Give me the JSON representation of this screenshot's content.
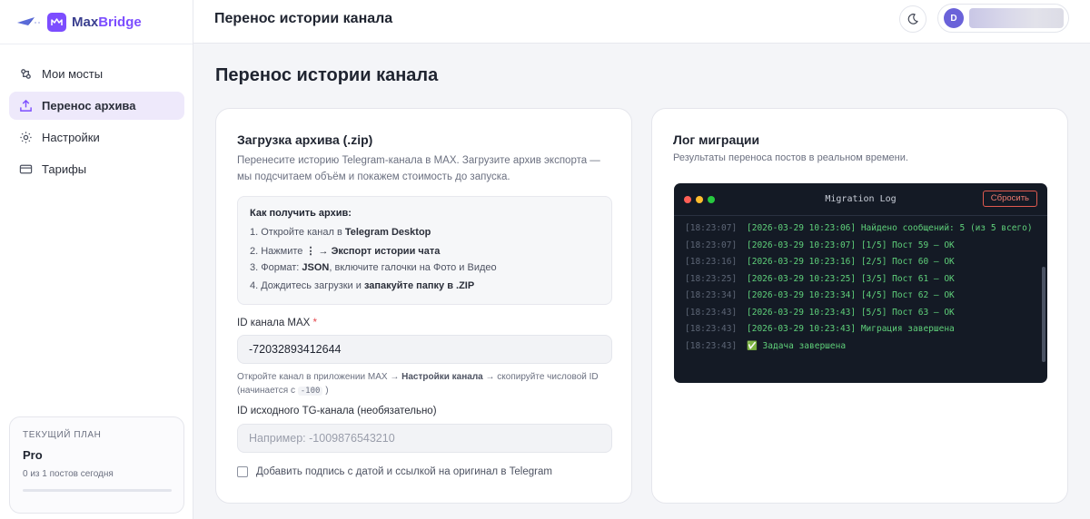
{
  "brand": {
    "name_part1": "Max",
    "name_part2": "Bridge"
  },
  "sidebar": {
    "items": [
      {
        "label": "Мои мосты",
        "icon": "bridge-icon"
      },
      {
        "label": "Перенос архива",
        "icon": "upload-icon",
        "active": true
      },
      {
        "label": "Настройки",
        "icon": "gear-icon"
      },
      {
        "label": "Тарифы",
        "icon": "card-icon"
      }
    ],
    "plan": {
      "label": "ТЕКУЩИЙ ПЛАН",
      "name": "Pro",
      "usage": "0 из 1 постов сегодня",
      "usage_fraction": 0
    }
  },
  "header": {
    "title": "Перенос истории канала",
    "user_initial": "D"
  },
  "page": {
    "heading": "Перенос истории канала"
  },
  "upload": {
    "title": "Загрузка архива (.zip)",
    "description": "Перенесите историю Telegram-канала в MAX. Загрузите архив экспорта — мы подсчитаем объём и покажем стоимость до запуска.",
    "howto": {
      "heading": "Как получить архив:",
      "s1_a": "1. Откройте канал в ",
      "s1_b": "Telegram Desktop",
      "s2_a": "2. Нажмите ",
      "s2_b": "⋮ → Экспорт истории чата",
      "s3_a": "3. Формат: ",
      "s3_b": "JSON",
      "s3_c": ", включите галочки на Фото и Видео",
      "s4_a": "4. Дождитесь загрузки и ",
      "s4_b": "запакуйте папку в .ZIP"
    },
    "max_id": {
      "label": "ID канала MAX",
      "required_mark": "*",
      "value": "-72032893412644",
      "hint_a": "Откройте канал в приложении MAX → ",
      "hint_b": "Настройки канала",
      "hint_c": " → скопируйте числовой ID (начинается с ",
      "hint_code": "-100",
      "hint_d": ")"
    },
    "tg_id": {
      "label": "ID исходного TG-канала (необязательно)",
      "placeholder": "Например: -1009876543210",
      "value": ""
    },
    "signature_checkbox": {
      "label": "Добавить подпись с датой и ссылкой на оригинал в Telegram",
      "checked": false
    }
  },
  "log": {
    "title": "Лог миграции",
    "description": "Результаты переноса постов в реальном времени.",
    "terminal_title": "Migration Log",
    "reset_label": "Сбросить",
    "lines": [
      {
        "ts": "[18:23:07]",
        "msg": "[2026-03-29 10:23:06] Найдено сообщений: 5 (из 5 всего)"
      },
      {
        "ts": "[18:23:07]",
        "msg": "[2026-03-29 10:23:07] [1/5] Пост 59 — OK"
      },
      {
        "ts": "[18:23:16]",
        "msg": "[2026-03-29 10:23:16] [2/5] Пост 60 — OK"
      },
      {
        "ts": "[18:23:25]",
        "msg": "[2026-03-29 10:23:25] [3/5] Пост 61 — OK"
      },
      {
        "ts": "[18:23:34]",
        "msg": "[2026-03-29 10:23:34] [4/5] Пост 62 — OK"
      },
      {
        "ts": "[18:23:43]",
        "msg": "[2026-03-29 10:23:43] [5/5] Пост 63 — OK"
      },
      {
        "ts": "[18:23:43]",
        "msg": "[2026-03-29 10:23:43] Миграция завершена"
      },
      {
        "ts": "[18:23:43]",
        "msg": "✅ Задача завершена"
      }
    ]
  },
  "colors": {
    "accent": "#7c4dff",
    "active_bg": "#eee9fb",
    "terminal_bg": "#141a25",
    "log_text": "#5fd07a",
    "reset": "#e05a4f"
  }
}
